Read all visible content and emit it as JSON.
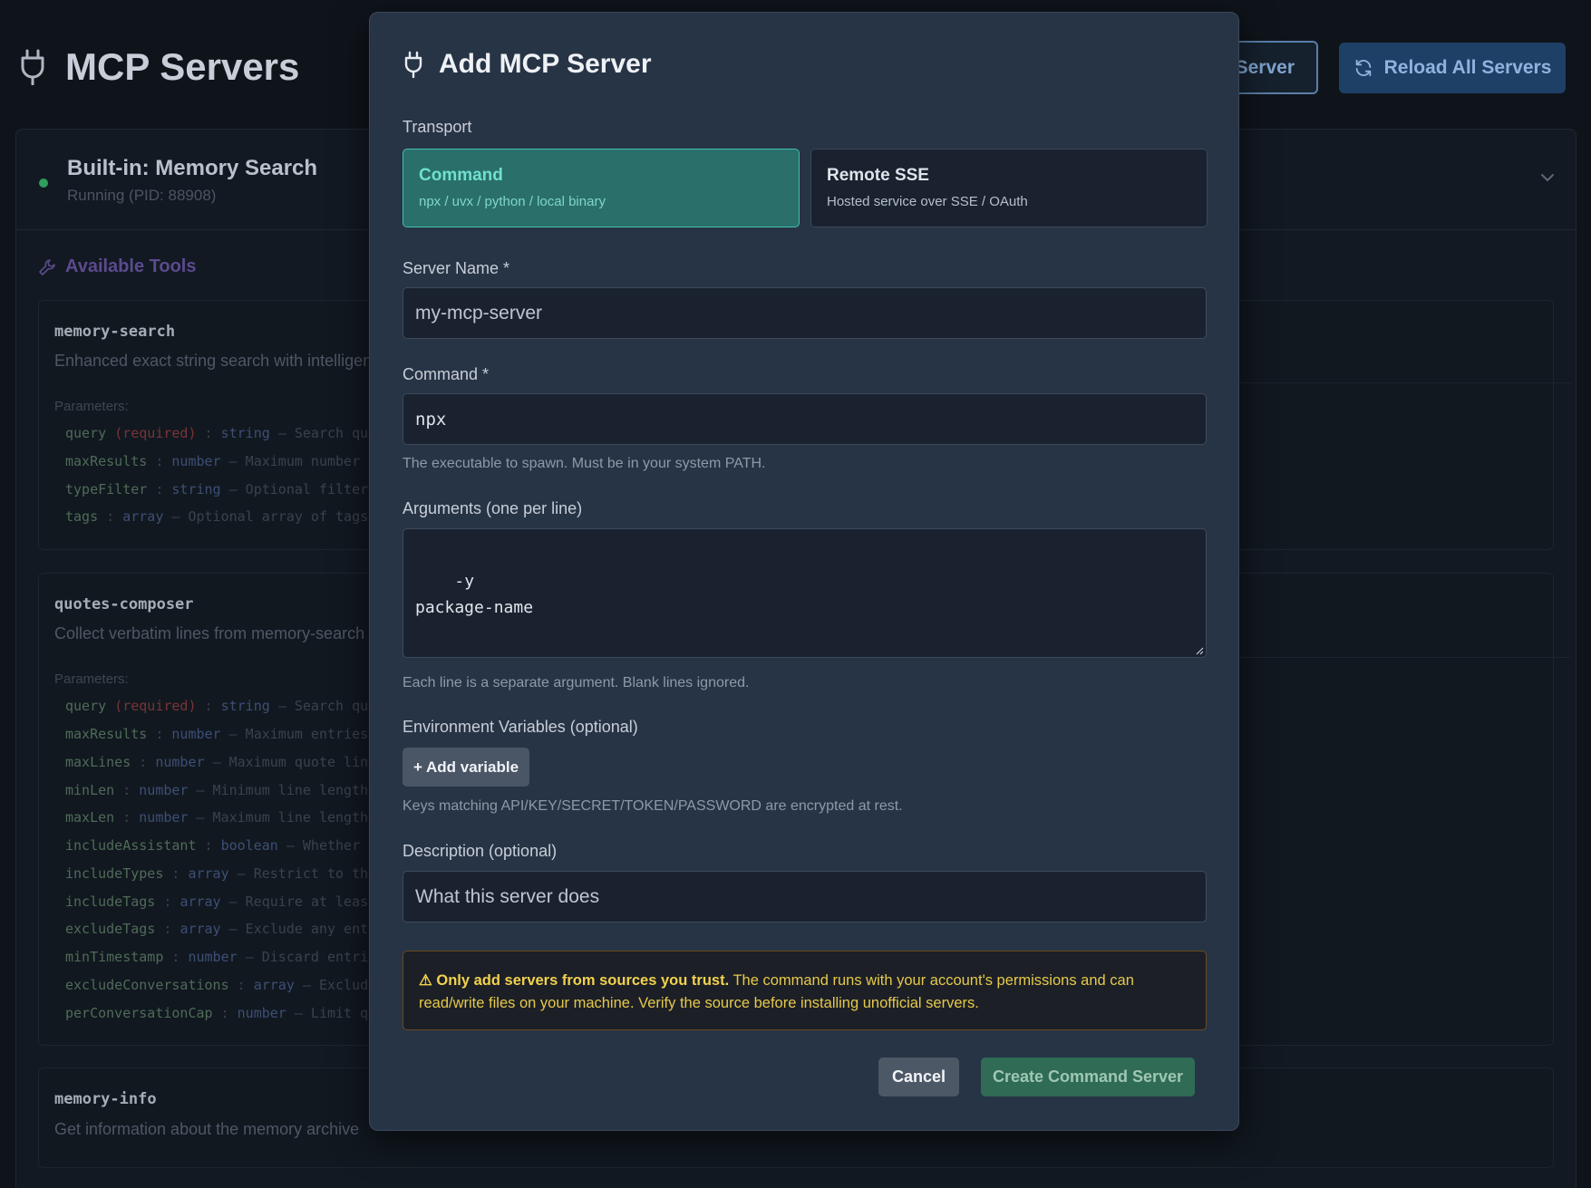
{
  "page": {
    "title": "MCP Servers",
    "add_server_label": "Server",
    "reload_label": "Reload All Servers"
  },
  "server": {
    "name": "Built-in: Memory Search",
    "status": "Running (PID: 88908)",
    "tools_heading": "Available Tools",
    "tools": [
      {
        "name": "memory-search",
        "description": "Enhanced exact string search with intelligen",
        "params_label": "Parameters:",
        "params": [
          {
            "name": "query",
            "required": "(required)",
            "type": "string",
            "desc": "— Search qu"
          },
          {
            "name": "maxResults",
            "required": "",
            "type": "number",
            "desc": "— Maximum number"
          },
          {
            "name": "typeFilter",
            "required": "",
            "type": "string",
            "desc": "— Optional filter"
          },
          {
            "name": "tags",
            "required": "",
            "type": "array",
            "desc": "— Optional array of tags"
          }
        ]
      },
      {
        "name": "quotes-composer",
        "description": "Collect verbatim lines from memory-search",
        "params_label": "Parameters:",
        "params": [
          {
            "name": "query",
            "required": "(required)",
            "type": "string",
            "desc": "— Search qu"
          },
          {
            "name": "maxResults",
            "required": "",
            "type": "number",
            "desc": "— Maximum entries"
          },
          {
            "name": "maxLines",
            "required": "",
            "type": "number",
            "desc": "— Maximum quote lin"
          },
          {
            "name": "minLen",
            "required": "",
            "type": "number",
            "desc": "— Minimum line length"
          },
          {
            "name": "maxLen",
            "required": "",
            "type": "number",
            "desc": "— Maximum line length"
          },
          {
            "name": "includeAssistant",
            "required": "",
            "type": "boolean",
            "desc": "— Whether"
          },
          {
            "name": "includeTypes",
            "required": "",
            "type": "array",
            "desc": "— Restrict to th"
          },
          {
            "name": "includeTags",
            "required": "",
            "type": "array",
            "desc": "— Require at leas"
          },
          {
            "name": "excludeTags",
            "required": "",
            "type": "array",
            "desc": "— Exclude any ent"
          },
          {
            "name": "minTimestamp",
            "required": "",
            "type": "number",
            "desc": "— Discard entri"
          },
          {
            "name": "excludeConversations",
            "required": "",
            "type": "array",
            "desc": "— Exclud"
          },
          {
            "name": "perConversationCap",
            "required": "",
            "type": "number",
            "desc": "— Limit q"
          }
        ]
      },
      {
        "name": "memory-info",
        "description": "Get information about the memory archive",
        "params_label": "",
        "params": []
      }
    ]
  },
  "modal": {
    "title": "Add MCP Server",
    "transport_label": "Transport",
    "transport_options": [
      {
        "title": "Command",
        "subtitle": "npx / uvx / python / local binary",
        "active": true
      },
      {
        "title": "Remote SSE",
        "subtitle": "Hosted service over SSE / OAuth",
        "active": false
      }
    ],
    "server_name_label": "Server Name *",
    "server_name_value": "my-mcp-server",
    "command_label": "Command *",
    "command_value": "npx",
    "command_hint": "The executable to spawn. Must be in your system PATH.",
    "arguments_label": "Arguments (one per line)",
    "arguments_value": "-y\npackage-name",
    "arguments_hint": "Each line is a separate argument. Blank lines ignored.",
    "env_label": "Environment Variables (optional)",
    "add_variable_label": "+ Add variable",
    "env_hint": "Keys matching API/KEY/SECRET/TOKEN/PASSWORD are encrypted at rest.",
    "description_label": "Description (optional)",
    "description_placeholder": "What this server does",
    "warning_bold": "⚠ Only add servers from sources you trust.",
    "warning_text": " The command runs with your account's permissions and can read/write files on your machine. Verify the source before installing unofficial servers.",
    "cancel_label": "Cancel",
    "create_label": "Create Command Server"
  },
  "colors": {
    "accent_teal": "#3fbfae",
    "create_green": "#2f6b55",
    "warning_yellow": "#e5c94b",
    "status_running": "#2f9e5f"
  },
  "icons": [
    "plug-icon",
    "refresh-icon",
    "chevron-down-icon",
    "wrench-icon",
    "warning-icon"
  ]
}
